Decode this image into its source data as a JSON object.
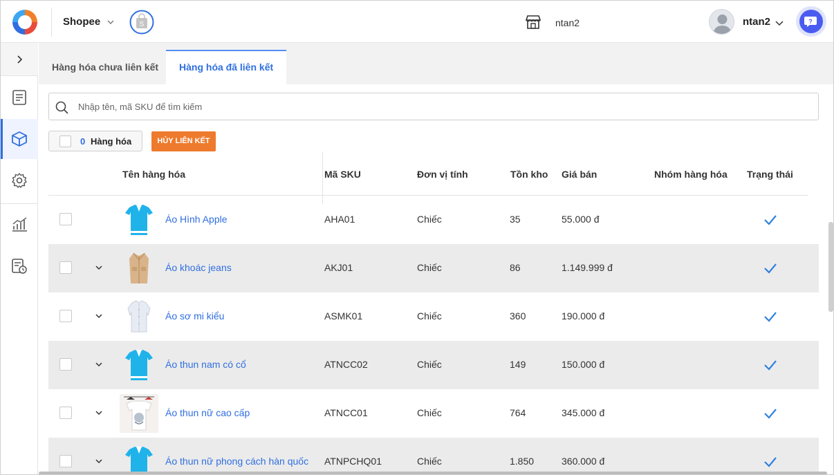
{
  "header": {
    "shop_name": "Shopee",
    "store_name": "ntan2",
    "user_name": "ntan2"
  },
  "sidebar": {
    "items": [
      {
        "icon": "document-icon"
      },
      {
        "icon": "box-icon",
        "active": true
      },
      {
        "icon": "gear-icon"
      },
      {
        "icon": "chart-icon"
      },
      {
        "icon": "report-clock-icon"
      }
    ]
  },
  "tabs": [
    {
      "label": "Hàng hóa chưa liên kết"
    },
    {
      "label": "Hàng hóa đã liên kết",
      "active": true
    }
  ],
  "search": {
    "placeholder": "Nhập tên, mã SKU để tìm kiếm",
    "value": ""
  },
  "selection": {
    "count": "0",
    "label": "Hàng hóa"
  },
  "toolbar": {
    "unlink_label": "HỦY LIÊN KẾT"
  },
  "table": {
    "columns": [
      "Tên hàng hóa",
      "Mã SKU",
      "Đơn vị tính",
      "Tồn kho",
      "Giá bán",
      "Nhóm hàng hóa",
      "Trạng thái"
    ],
    "rows": [
      {
        "name": "Áo Hình Apple",
        "sku": "AHA01",
        "unit": "Chiếc",
        "stock": "35",
        "price": "55.000 đ",
        "group": "",
        "linked": true,
        "thumb": "blue-polo"
      },
      {
        "name": "Áo khoác jeans",
        "sku": "AKJ01",
        "unit": "Chiếc",
        "stock": "86",
        "price": "1.149.999 đ",
        "group": "",
        "linked": true,
        "thumb": "tan-coat"
      },
      {
        "name": "Áo sơ mi kiểu",
        "sku": "ASMK01",
        "unit": "Chiếc",
        "stock": "360",
        "price": "190.000 đ",
        "group": "",
        "linked": true,
        "thumb": "white-shirt"
      },
      {
        "name": "Áo thun nam có cổ",
        "sku": "ATNCC02",
        "unit": "Chiếc",
        "stock": "149",
        "price": "150.000 đ",
        "group": "",
        "linked": true,
        "thumb": "blue-polo"
      },
      {
        "name": "Áo thun nữ cao cấp",
        "sku": "ATNCC01",
        "unit": "Chiếc",
        "stock": "764",
        "price": "345.000 đ",
        "group": "",
        "linked": true,
        "thumb": "tshirt-photo"
      },
      {
        "name": "Áo thun nữ phong cách hàn quốc",
        "sku": "ATNPCHQ01",
        "unit": "Chiếc",
        "stock": "1.850",
        "price": "360.000 đ",
        "group": "",
        "linked": true,
        "thumb": "blue-polo"
      }
    ]
  },
  "colors": {
    "accent": "#2f6fe0",
    "unlink_button": "#ee7a2d",
    "row_alt": "#ebebeb"
  }
}
